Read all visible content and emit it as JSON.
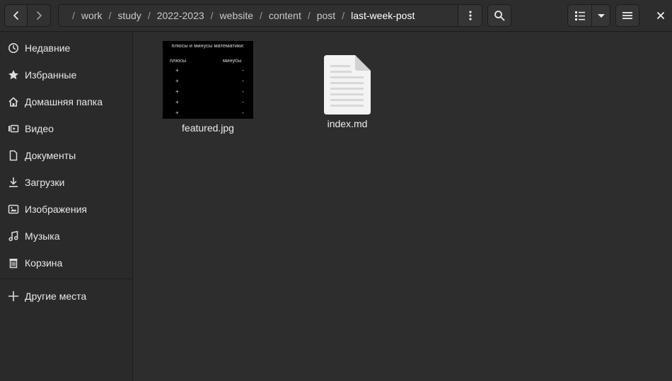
{
  "header": {
    "breadcrumbs": [
      "work",
      "study",
      "2022-2023",
      "website",
      "content",
      "post",
      "last-week-post"
    ]
  },
  "sidebar": {
    "items": [
      {
        "label": "Недавние",
        "icon": "clock-icon"
      },
      {
        "label": "Избранные",
        "icon": "star-icon"
      },
      {
        "label": "Домашняя папка",
        "icon": "home-icon"
      },
      {
        "label": "Видео",
        "icon": "video-icon"
      },
      {
        "label": "Документы",
        "icon": "document-icon"
      },
      {
        "label": "Загрузки",
        "icon": "download-icon"
      },
      {
        "label": "Изображения",
        "icon": "image-icon"
      },
      {
        "label": "Музыка",
        "icon": "music-icon"
      },
      {
        "label": "Корзина",
        "icon": "trash-icon"
      }
    ],
    "other_places": {
      "label": "Другие места",
      "icon": "plus-icon"
    }
  },
  "files": [
    {
      "name": "featured.jpg",
      "thumbnail": {
        "title": "плюсы и минусы математики:",
        "col_left": "плюсы",
        "col_right": "минусы",
        "left_rows": [
          "+",
          "+",
          "+",
          "+",
          "+"
        ],
        "right_rows": [
          "-",
          "-",
          "-",
          "-",
          "-"
        ]
      }
    },
    {
      "name": "index.md"
    }
  ],
  "colors": {
    "background": "#2d2d2d",
    "sidebar": "#2a2a2a",
    "text": "#e6e6e6"
  }
}
